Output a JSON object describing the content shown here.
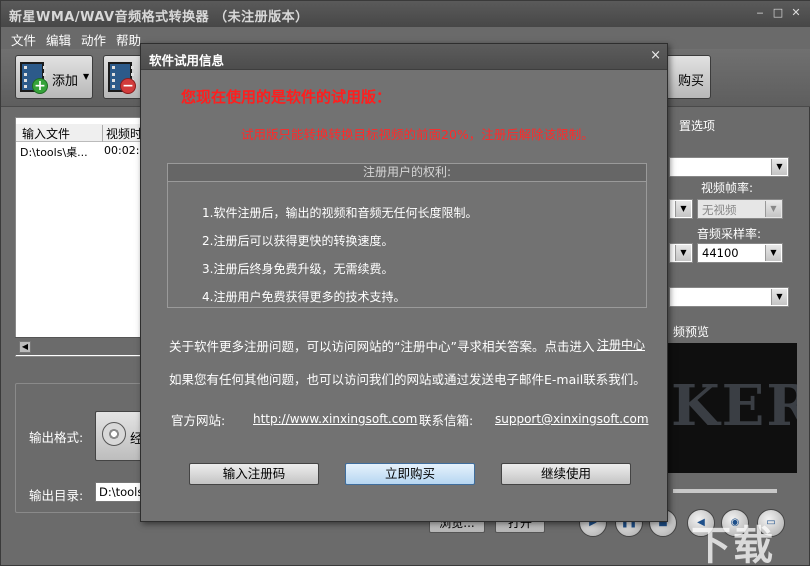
{
  "window": {
    "title": "新星WMA/WAV音频格式转换器 （未注册版本）",
    "controls": [
      "‒",
      "□",
      "✕"
    ]
  },
  "menu": [
    "文件",
    "编辑",
    "动作",
    "帮助"
  ],
  "toolbar": {
    "add_label": "添加",
    "buy_label": "购买"
  },
  "file_list": {
    "columns": [
      "输入文件",
      "视频时"
    ],
    "rows": [
      {
        "file": "D:\\tools\\桌...",
        "duration": "00:02:1"
      }
    ]
  },
  "output": {
    "format_label": "输出格式:",
    "format_value": "经",
    "dir_label": "输出目录:",
    "dir_value": "D:\\tools\\",
    "browse_label": "浏览...",
    "open_label": "打开"
  },
  "settings": {
    "section_label": "置选项",
    "frame_rate_label": "视频帧率:",
    "frame_rate_value": "无视频",
    "sample_rate_label": "音频采样率:",
    "sample_rate_value": "44100",
    "preview_label": "频预览",
    "preview_text": "KER"
  },
  "dialog": {
    "title": "软件试用信息",
    "close": "×",
    "heading": "您现在使用的是软件的试用版：",
    "subheading": "试用版只能转换转换目标视频的前面20%，注册后解除该限制。",
    "rights_header": "注册用户的权利:",
    "rights": [
      "1.软件注册后，输出的视频和音频无任何长度限制。",
      "2.注册后可以获得更快的转换速度。",
      "3.注册后终身免费升级，无需续费。",
      "4.注册用户免费获得更多的技术支持。"
    ],
    "more_info": "关于软件更多注册问题，可以访问网站的“注册中心”寻求相关答案。点击进入",
    "more_info_link": "注册中心",
    "contact_info": "如果您有任何其他问题，也可以访问我们的网站或通过发送电子邮件E-mail联系我们。",
    "site_label": "官方网站:",
    "site_url": "http://www.xinxingsoft.com",
    "mail_label": "联系信箱:",
    "mail_address": "support@xinxingsoft.com",
    "btn_register": "输入注册码",
    "btn_buy": "立即购买",
    "btn_continue": "继续使用"
  },
  "watermark": "下载"
}
